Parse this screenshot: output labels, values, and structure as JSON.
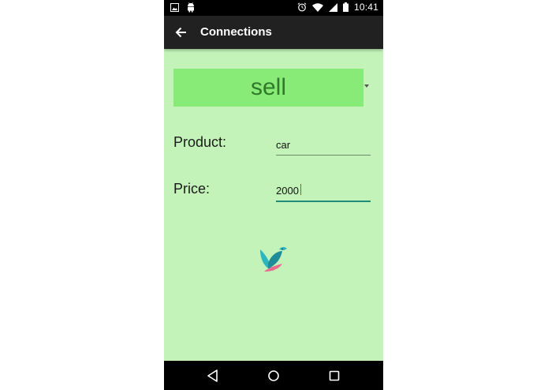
{
  "status_bar": {
    "time": "10:41",
    "left_icons": [
      "image-icon",
      "android-icon"
    ],
    "right_icons": [
      "alarm-icon",
      "wifi-icon",
      "signal-icon",
      "battery-icon"
    ]
  },
  "action_bar": {
    "title": "Connections",
    "back_icon": "arrow-back-icon",
    "background": "#212121"
  },
  "spinner": {
    "selected": "sell",
    "background": "#89eb77",
    "text_color": "#2f7a29"
  },
  "form": {
    "product_label": "Product:",
    "product_value": "car",
    "price_label": "Price:",
    "price_value": "2000"
  },
  "colors": {
    "screen_background": "#c3f3b9",
    "focus_accent": "#1f8a78"
  },
  "logo": {
    "icon": "bird-logo-icon"
  },
  "nav_bar": {
    "back_icon": "nav-back-icon",
    "home_icon": "nav-home-icon",
    "recents_icon": "nav-recents-icon"
  }
}
